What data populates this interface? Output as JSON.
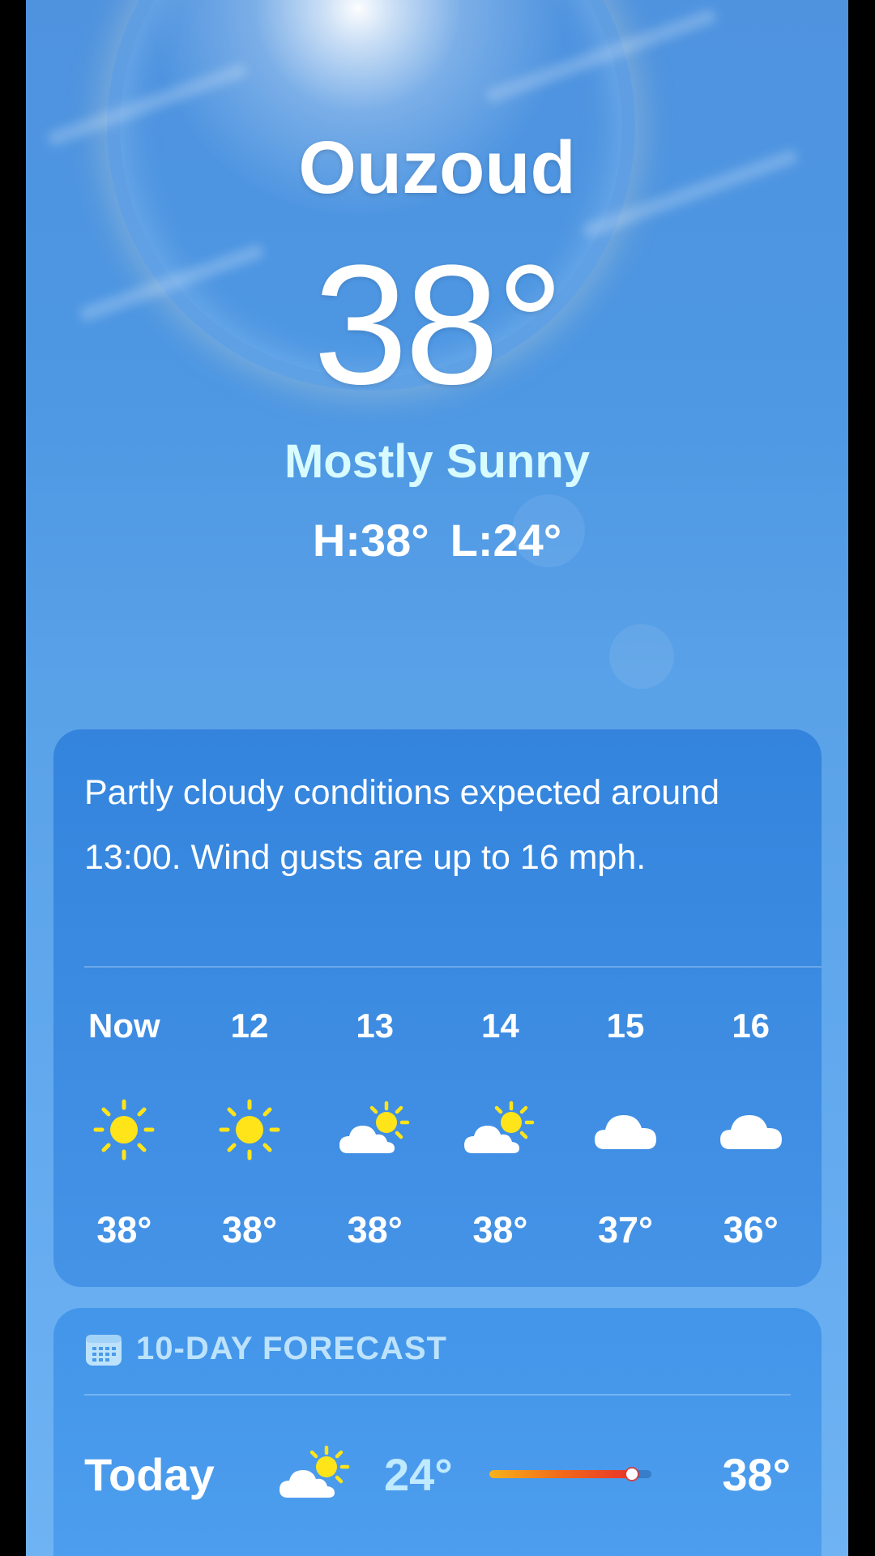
{
  "location": {
    "city": "Ouzoud"
  },
  "current": {
    "temperature": "38°",
    "condition": "Mostly Sunny",
    "high": "H:38°",
    "low": "L:24°"
  },
  "hourly_card": {
    "summary": "Partly cloudy conditions expected around 13:00. Wind gusts are up to 16 mph.",
    "hours": [
      {
        "time": "Now",
        "icon": "sun-icon",
        "temp": "38°"
      },
      {
        "time": "12",
        "icon": "sun-icon",
        "temp": "38°"
      },
      {
        "time": "13",
        "icon": "partly-cloudy-icon",
        "temp": "38°"
      },
      {
        "time": "14",
        "icon": "partly-cloudy-icon",
        "temp": "38°"
      },
      {
        "time": "15",
        "icon": "cloud-icon",
        "temp": "37°"
      },
      {
        "time": "16",
        "icon": "cloud-icon",
        "temp": "36°"
      }
    ]
  },
  "forecast_card": {
    "header": "10-DAY FORECAST",
    "header_icon": "calendar-icon",
    "days": [
      {
        "day": "Today",
        "icon": "partly-cloudy-icon",
        "low": "24°",
        "high": "38°",
        "current_marker_fraction": 1.0
      }
    ]
  },
  "colors": {
    "condition_text": "#d8fbff",
    "sun_yellow": "#ffe41a",
    "range_gradient": [
      "#f7b21a",
      "#e8342a"
    ]
  }
}
